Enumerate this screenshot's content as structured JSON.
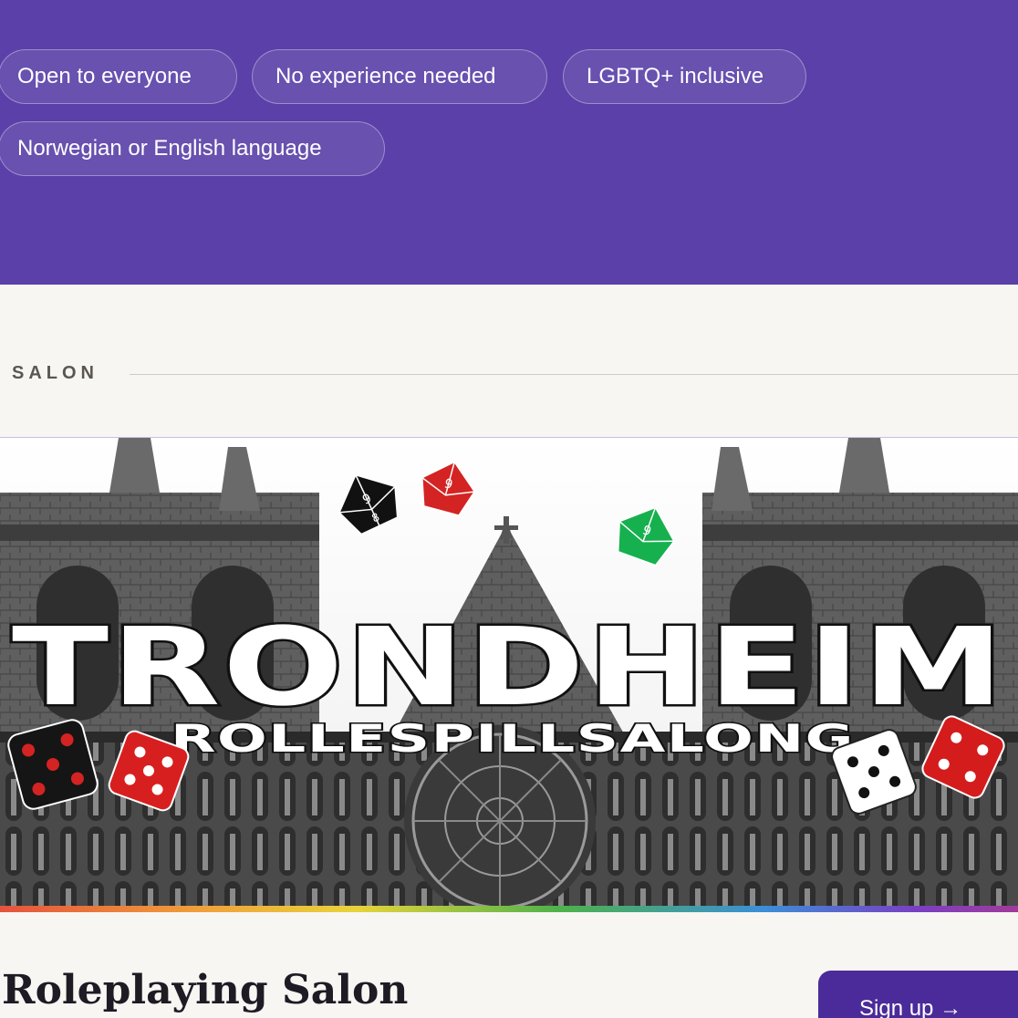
{
  "hero": {
    "tags": [
      "Open to everyone",
      "No experience needed",
      "LGBTQ+ inclusive",
      "Norwegian or English language"
    ],
    "background_color": "#5a40a8"
  },
  "section": {
    "eyebrow": "SALON"
  },
  "banner": {
    "headline": "TRONDHEIM",
    "subheadline": "ROLLESPILLSALONG"
  },
  "event": {
    "title": "Roleplaying Salon",
    "signup_label": "Sign up →",
    "accent_color": "#4b2b99"
  }
}
